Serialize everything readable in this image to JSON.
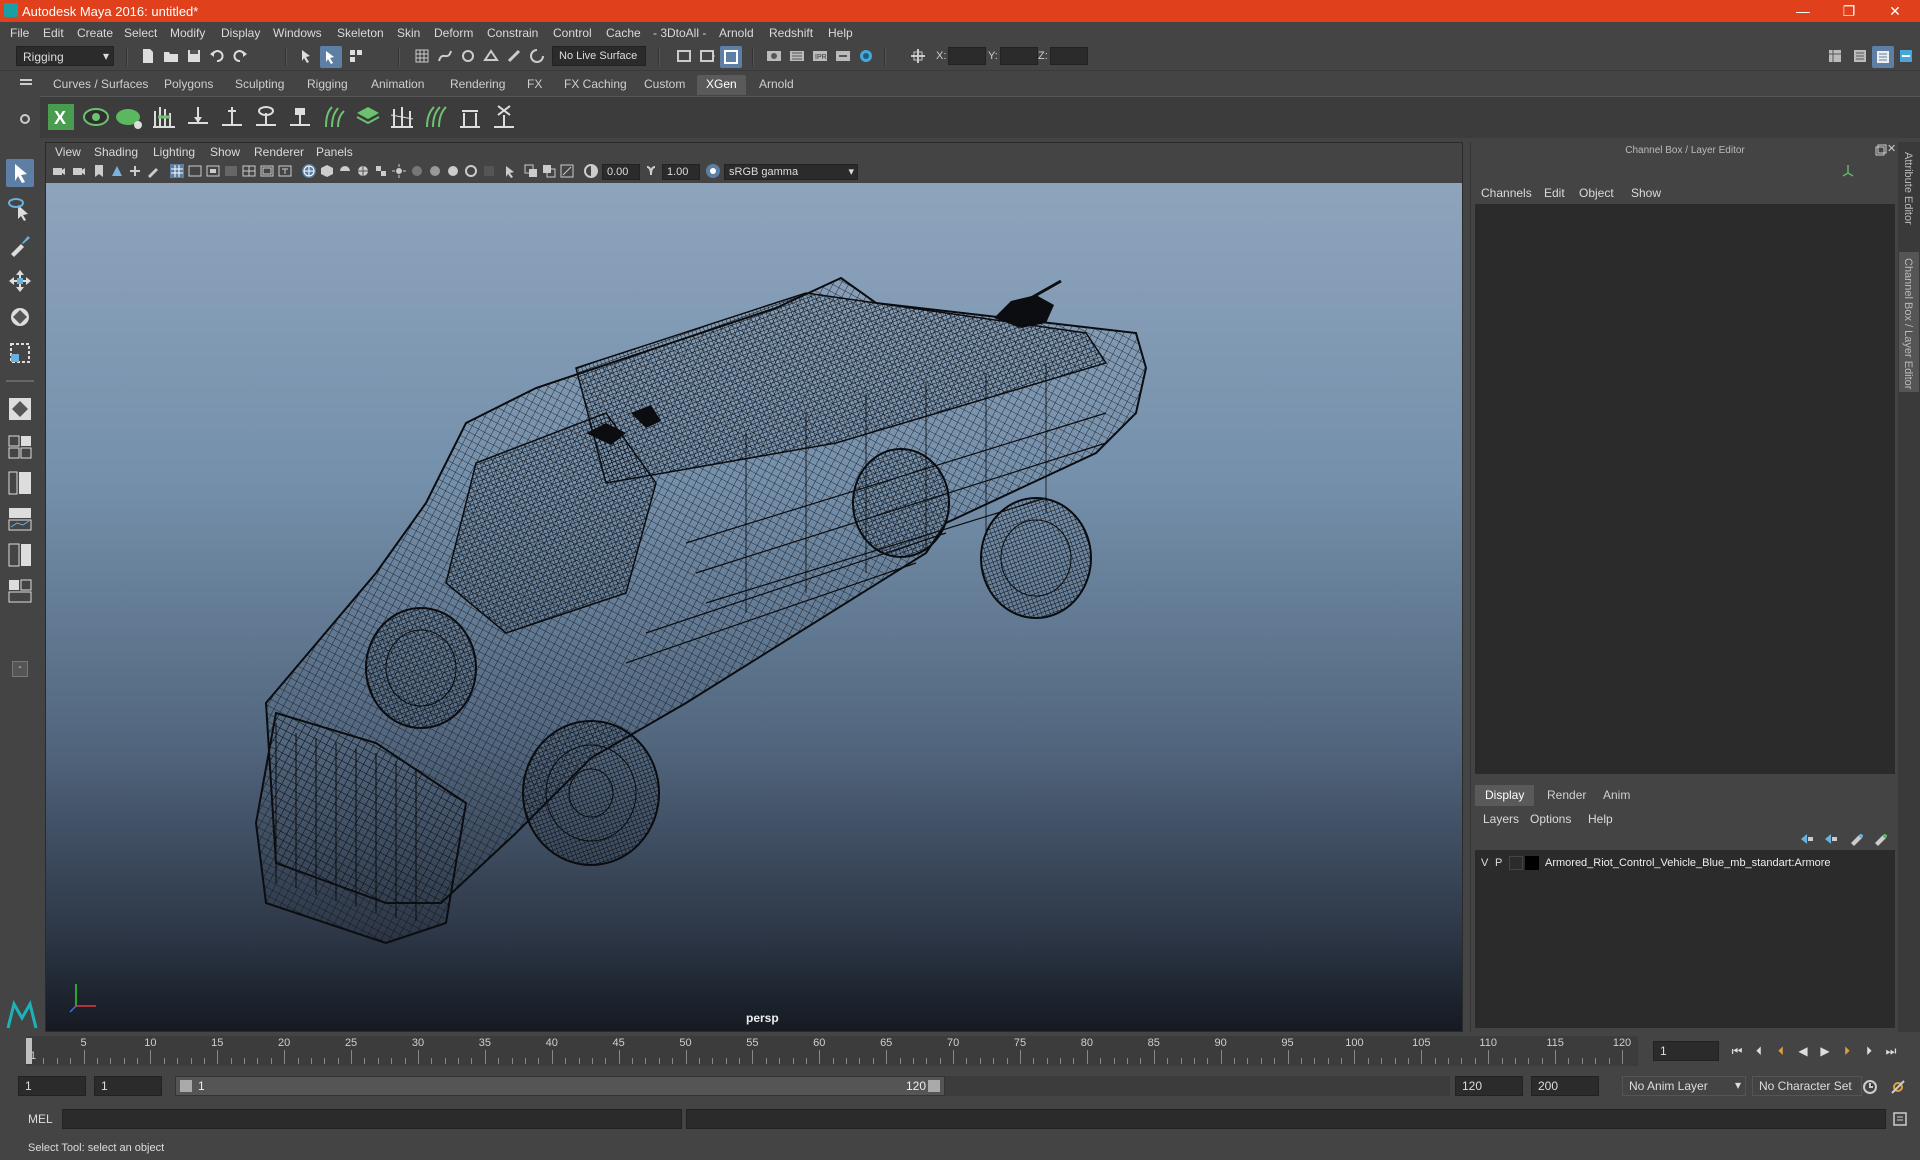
{
  "window": {
    "title": "Autodesk Maya 2016: untitled*",
    "minimize": "—",
    "maximize": "❐",
    "close": "✕"
  },
  "menubar": [
    "File",
    "Edit",
    "Create",
    "Select",
    "Modify",
    "Display",
    "Windows",
    "Skeleton",
    "Skin",
    "Deform",
    "Constrain",
    "Control",
    "Cache",
    "- 3DtoAll -",
    "Arnold",
    "Redshift",
    "Help"
  ],
  "statusline": {
    "menuset": "Rigging",
    "live_surface": "No Live Surface",
    "x_label": "X:",
    "y_label": "Y:",
    "z_label": "Z:"
  },
  "shelf_tabs": [
    "Curves / Surfaces",
    "Polygons",
    "Sculpting",
    "Rigging",
    "Animation",
    "Rendering",
    "FX",
    "FX Caching",
    "Custom",
    "XGen",
    "Arnold"
  ],
  "active_shelf": "XGen",
  "viewport": {
    "menu": [
      "View",
      "Shading",
      "Lighting",
      "Show",
      "Renderer",
      "Panels"
    ],
    "exposure": "0.00",
    "gamma": "1.00",
    "color_space": "sRGB gamma",
    "camera_label": "persp"
  },
  "channel_box": {
    "title": "Channel Box / Layer Editor",
    "menu": [
      "Channels",
      "Edit",
      "Object",
      "Show"
    ],
    "layer_tabs": [
      "Display",
      "Render",
      "Anim"
    ],
    "active_layer_tab": "Display",
    "layer_menu": [
      "Layers",
      "Options",
      "Help"
    ],
    "layers": [
      {
        "v": "V",
        "p": "P",
        "name": "Armored_Riot_Control_Vehicle_Blue_mb_standart:Armore"
      }
    ]
  },
  "side_tabs": [
    "Attribute Editor",
    "Channel Box / Layer Editor"
  ],
  "timeline": {
    "ticks": [
      1,
      5,
      10,
      15,
      20,
      25,
      30,
      35,
      40,
      45,
      50,
      55,
      60,
      65,
      70,
      75,
      80,
      85,
      90,
      95,
      100,
      105,
      110,
      115,
      120
    ],
    "current_frame": "1",
    "range_min": 1,
    "range_max": 120
  },
  "range": {
    "start": "1",
    "inner_start": "1",
    "slider_start": "1",
    "slider_end": "120",
    "end": "120",
    "outer_end": "200",
    "anim_layer": "No Anim Layer",
    "char_set": "No Character Set"
  },
  "command": {
    "lang": "MEL"
  },
  "helpline": "Select Tool: select an object"
}
